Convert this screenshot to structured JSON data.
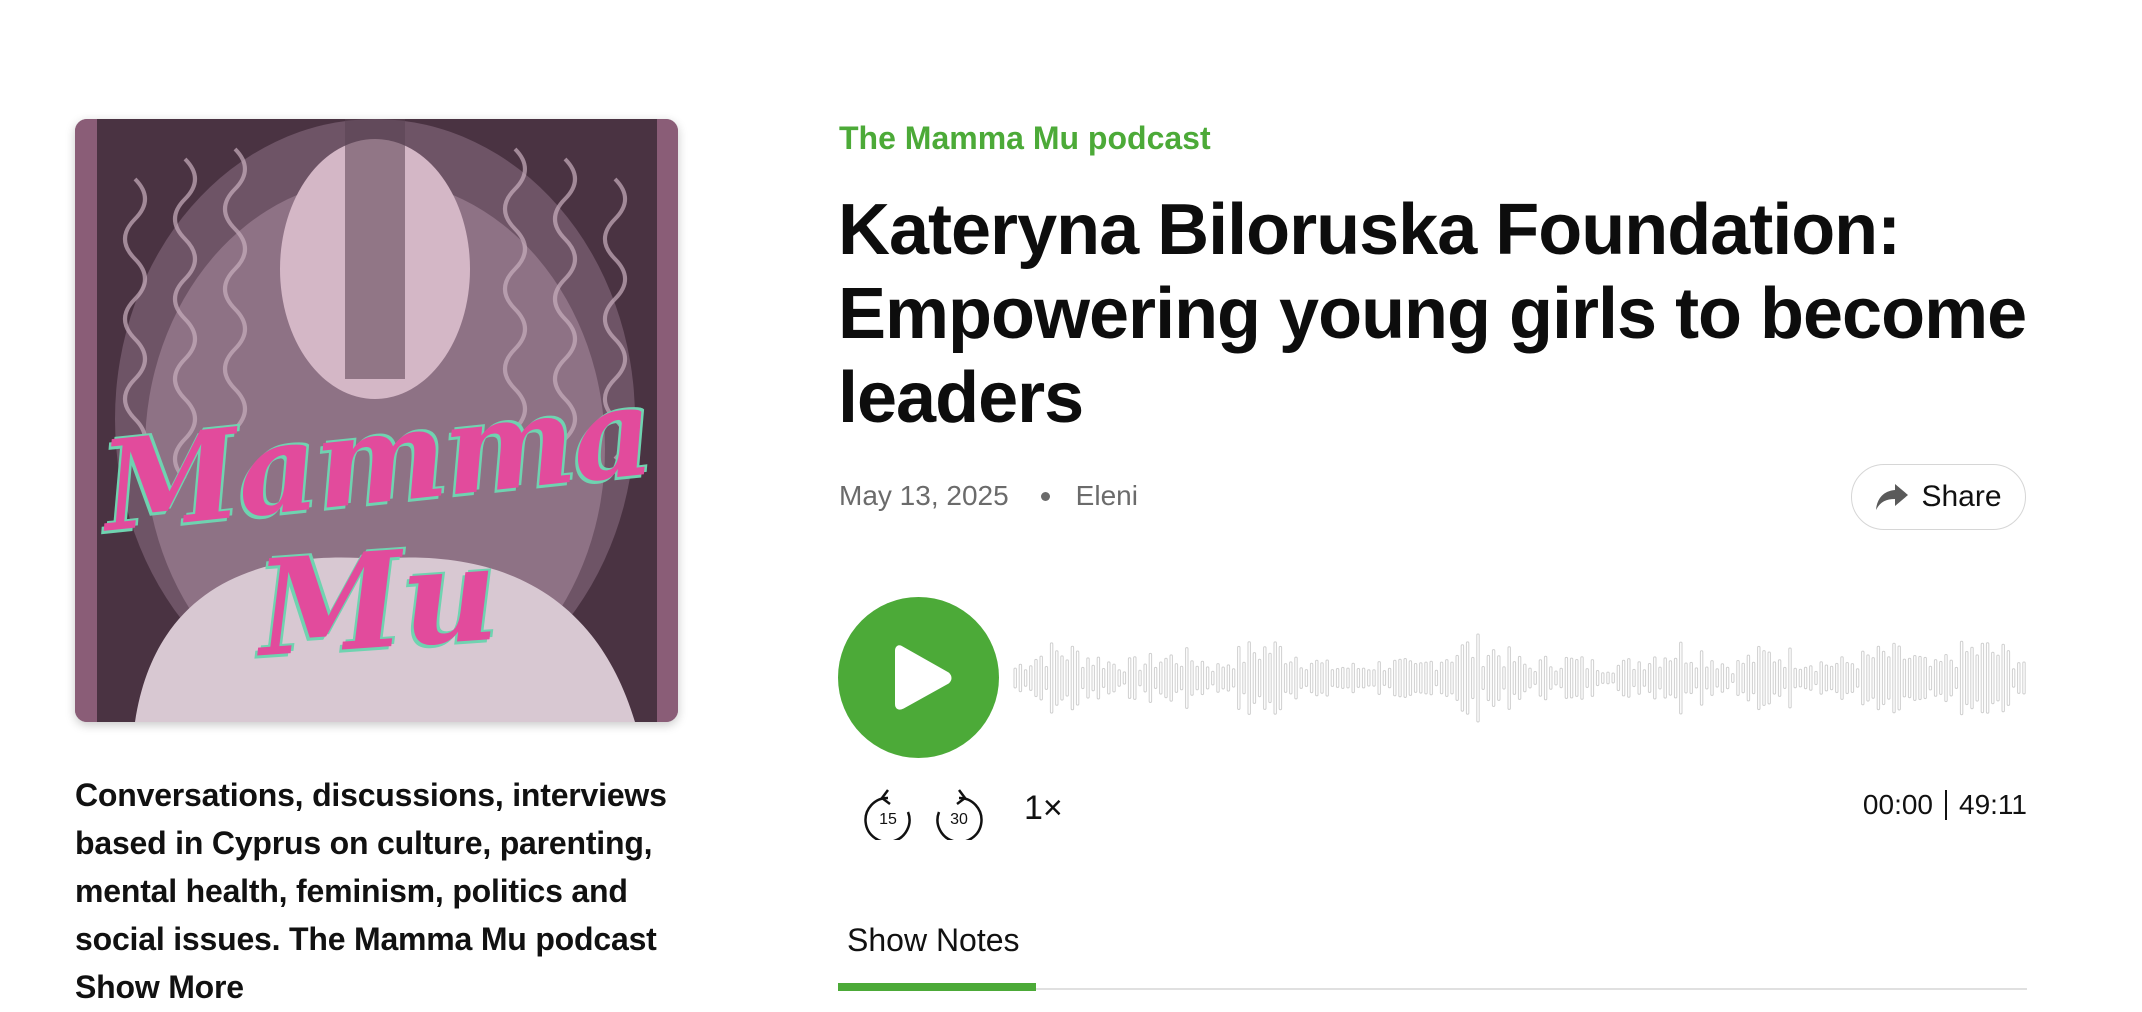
{
  "colors": {
    "accent": "#4caa38",
    "text": "#111111",
    "muted": "#6b6b6b",
    "waveform": "#cfcfcf",
    "cover_bg": "#4a3342",
    "logo_pink": "#e24b9c",
    "logo_mint": "#6fd3b0"
  },
  "cover": {
    "logo_line1": "Mamma",
    "logo_line2": "Mu"
  },
  "podcast": {
    "name": "The Mamma Mu podcast",
    "description": "Conversations, discussions, interviews based in Cyprus on culture, parenting, mental health, feminism, politics and social issues. The Mamma Mu podcast",
    "show_more_label": "Show More"
  },
  "episode": {
    "title": "Kateryna Biloruska Foundation: Empowering young girls to become leaders",
    "date": "May 13, 2025",
    "author": "Eleni"
  },
  "actions": {
    "share_label": "Share",
    "share_icon": "share-arrow-icon",
    "play_icon": "play-icon"
  },
  "player": {
    "rewind_label": "15",
    "forward_label": "30",
    "speed_label": "1×",
    "current_time": "00:00",
    "duration": "49:11",
    "progress": 0
  },
  "tabs": [
    {
      "label": "Show Notes",
      "active": true
    }
  ]
}
